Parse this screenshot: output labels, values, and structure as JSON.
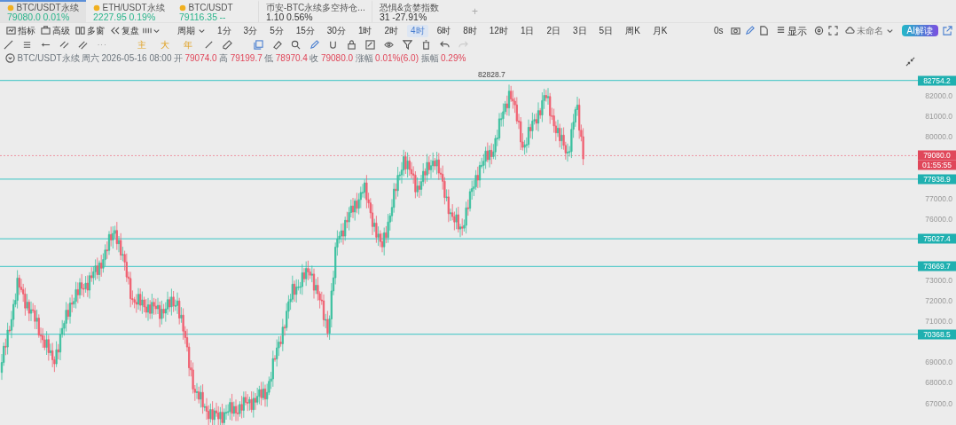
{
  "tickers": [
    {
      "symbol": "BTC/USDT永续",
      "price": "79080.0",
      "change": "0.01%",
      "kind": "coin",
      "selected": true
    },
    {
      "symbol": "ETH/USDT永续",
      "price": "2227.95",
      "change": "0.19%",
      "kind": "coin",
      "selected": false
    },
    {
      "symbol": "BTC/USDT",
      "price": "79116.35",
      "change": "--",
      "kind": "coin",
      "selected": false
    },
    {
      "symbol": "币安-BTC永续多空持仓...",
      "price": "1.10",
      "change": "0.56%",
      "kind": "index",
      "selected": false
    },
    {
      "symbol": "恐惧&贪婪指数",
      "price": "31",
      "change": "-27.91%",
      "kind": "index",
      "selected": false
    }
  ],
  "add_tab": "+",
  "toolbar": {
    "tools": [
      {
        "label": "指标",
        "kind": "indicator"
      },
      {
        "label": "高级",
        "kind": "advanced"
      },
      {
        "label": "多窗",
        "kind": "multi"
      },
      {
        "label": "复盘",
        "kind": "replay"
      }
    ],
    "period_label": "周期",
    "periods": [
      {
        "label": "1分",
        "selected": false
      },
      {
        "label": "3分",
        "selected": false
      },
      {
        "label": "5分",
        "selected": false
      },
      {
        "label": "15分",
        "selected": false
      },
      {
        "label": "30分",
        "selected": false
      },
      {
        "label": "1时",
        "selected": false
      },
      {
        "label": "2时",
        "selected": false
      },
      {
        "label": "4时",
        "selected": true
      },
      {
        "label": "6时",
        "selected": false
      },
      {
        "label": "8时",
        "selected": false
      },
      {
        "label": "12时",
        "selected": false
      },
      {
        "label": "1日",
        "selected": false
      },
      {
        "label": "2日",
        "selected": false
      },
      {
        "label": "3日",
        "selected": false
      },
      {
        "label": "5日",
        "selected": false
      },
      {
        "label": "周K",
        "selected": false
      },
      {
        "label": "月K",
        "selected": false
      }
    ],
    "timer": "0s",
    "display": "显示",
    "layout_name": "未命名",
    "ai_button": "AI解读"
  },
  "drawing_chars": [
    "主",
    "大",
    "年"
  ],
  "info": {
    "symbol": "BTC/USDT永续",
    "weekday": "周六",
    "datetime": "2026-05-16 08:00",
    "fields": [
      {
        "label": "开",
        "value": "79074.0"
      },
      {
        "label": "高",
        "value": "79199.7"
      },
      {
        "label": "低",
        "value": "78970.4"
      },
      {
        "label": "收",
        "value": "79080.0"
      },
      {
        "label": "涨幅",
        "value": "0.01%(6.0)"
      },
      {
        "label": "振幅",
        "value": "0.29%"
      }
    ]
  },
  "chart": {
    "high_marker": "82828.7",
    "countdown": "01:55:55",
    "axis_labels": [
      "82000.0",
      "81000.0",
      "80000.0",
      "77000.0",
      "76000.0",
      "73000.0",
      "72000.0",
      "71000.0",
      "69000.0",
      "68000.0",
      "67000.0"
    ],
    "price_lines": [
      {
        "value": "82754.2",
        "kind": "level"
      },
      {
        "value": "79080.0",
        "kind": "last"
      },
      {
        "value": "77938.9",
        "kind": "level"
      },
      {
        "value": "75027.4",
        "kind": "level"
      },
      {
        "value": "73669.7",
        "kind": "level"
      },
      {
        "value": "70368.5",
        "kind": "level"
      }
    ]
  }
}
